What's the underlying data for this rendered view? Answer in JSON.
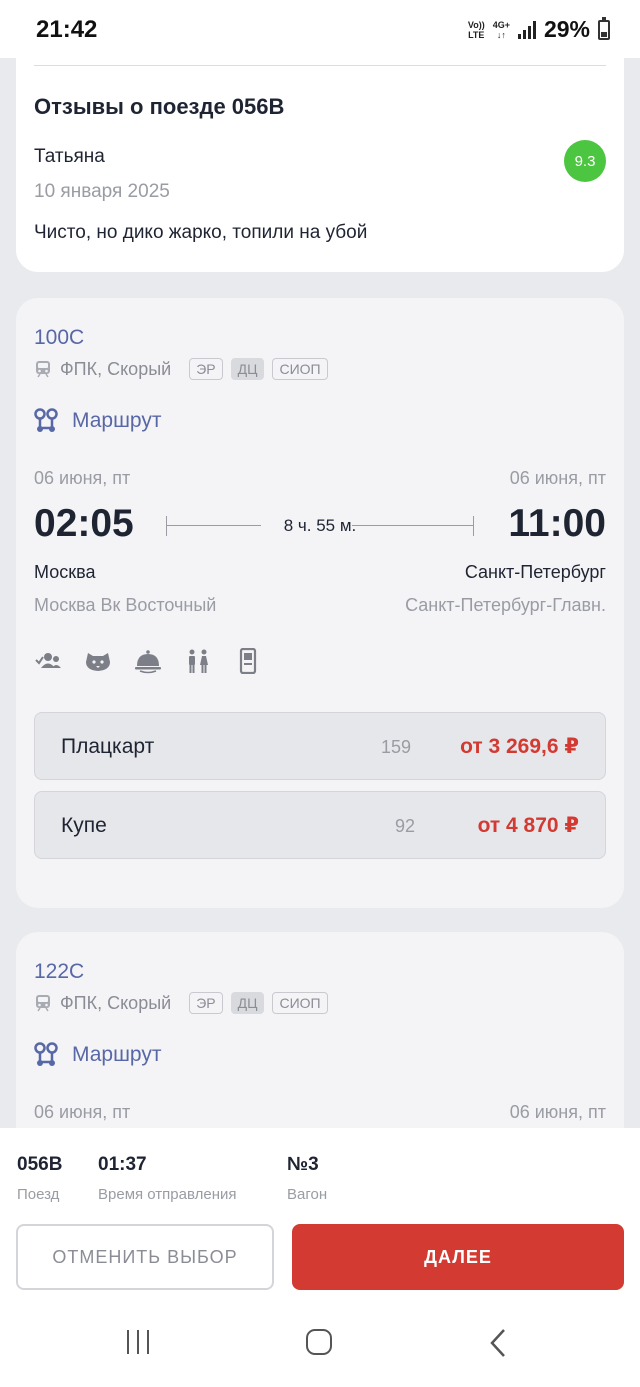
{
  "status_bar": {
    "time": "21:42",
    "volte_top": "Vo))",
    "volte_bottom": "LTE",
    "network": "4G+",
    "battery": "29%"
  },
  "review": {
    "title": "Отзывы о поезде 056В",
    "author": "Татьяна",
    "date": "10 января 2025",
    "text": "Чисто, но дико жарко, топили на убой",
    "score": "9.3",
    "score_color": "#4cc541"
  },
  "trains": [
    {
      "number": "100С",
      "carrier": "ФПК, Скорый",
      "tags": [
        "ЭР",
        "ДЦ",
        "СИОП"
      ],
      "route_label": "Маршрут",
      "dep_date": "06 июня, пт",
      "arr_date": "06 июня, пт",
      "dep_time": "02:05",
      "arr_time": "11:00",
      "duration": "8 ч. 55 м.",
      "dep_city": "Москва",
      "arr_city": "Санкт-Петербург",
      "dep_station": "Москва Вк Восточный",
      "arr_station": "Санкт-Петербург-Главн.",
      "amenities": [
        "passengers-icon",
        "pet-icon",
        "meal-icon",
        "restroom-icon",
        "eticket-icon"
      ],
      "classes": [
        {
          "name": "Плацкарт",
          "seats": "159",
          "price": "от 3 269,6 ₽"
        },
        {
          "name": "Купе",
          "seats": "92",
          "price": "от 4 870 ₽"
        }
      ]
    },
    {
      "number": "122С",
      "carrier": "ФПК, Скорый",
      "tags": [
        "ЭР",
        "ДЦ",
        "СИОП"
      ],
      "route_label": "Маршрут",
      "dep_date": "06 июня, пт",
      "arr_date": "06 июня, пт"
    }
  ],
  "selection": {
    "train_value": "056В",
    "train_caption": "Поезд",
    "departure_value": "01:37",
    "departure_caption": "Время отправления",
    "car_value": "№3",
    "car_caption": "Вагон"
  },
  "buttons": {
    "cancel": "ОТМЕНИТЬ ВЫБОР",
    "next": "ДАЛЕЕ"
  },
  "colors": {
    "accent": "#5867a6",
    "price": "#d23a32",
    "primary_button": "#d23a32"
  }
}
